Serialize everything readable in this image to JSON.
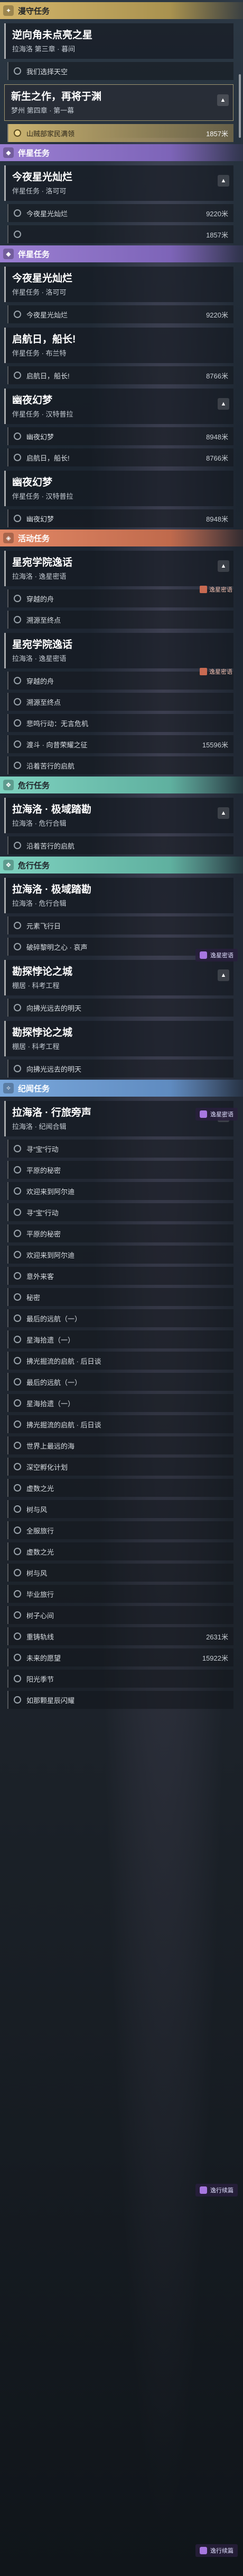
{
  "sections": [
    {
      "type": "cat",
      "style": "gold",
      "icon": "✦",
      "label": "漫守任务"
    },
    {
      "type": "quest",
      "title": "逆向角未点亮之星",
      "sub": "拉海洛 第三章 · 暮间",
      "badge": ""
    },
    {
      "type": "step",
      "label": "我们选择天空",
      "dist": ""
    },
    {
      "type": "quest",
      "sel": true,
      "title": "新生之作，再将于渊",
      "sub": "梦州 第四章 · 第一幕",
      "badge": "▲"
    },
    {
      "type": "step",
      "hl": true,
      "label": "山贼部家民满领",
      "dist": "1857米"
    },
    {
      "type": "cat",
      "style": "purple",
      "icon": "◆",
      "label": "伴星任务"
    },
    {
      "type": "quest",
      "title": "今夜星光灿烂",
      "sub": "伴星任务 · 洛可可",
      "badge": "▲"
    },
    {
      "type": "step",
      "label": "今夜星光灿烂",
      "dist": "9220米"
    },
    {
      "type": "step",
      "label": "",
      "dist": "1857米"
    },
    {
      "type": "cat",
      "style": "purple",
      "icon": "◆",
      "label": "伴星任务"
    },
    {
      "type": "quest",
      "title": "今夜星光灿烂",
      "sub": "伴星任务 · 洛可可",
      "badge": ""
    },
    {
      "type": "step",
      "label": "今夜星光灿烂",
      "dist": "9220米"
    },
    {
      "type": "quest",
      "title": "启航日，船长!",
      "sub": "伴星任务 · 布兰特",
      "badge": ""
    },
    {
      "type": "step",
      "label": "启航日，船长!",
      "dist": "8766米"
    },
    {
      "type": "quest",
      "title": "幽夜幻梦",
      "sub": "伴星任务 · 汉特普拉",
      "badge": "▲"
    },
    {
      "type": "step",
      "label": "幽夜幻梦",
      "dist": "8948米"
    },
    {
      "type": "step",
      "label": "启航日，船长!",
      "dist": "8766米"
    },
    {
      "type": "quest",
      "title": "幽夜幻梦",
      "sub": "伴星任务 · 汉特普拉",
      "badge": ""
    },
    {
      "type": "step",
      "label": "幽夜幻梦",
      "dist": "8948米"
    },
    {
      "type": "cat",
      "style": "orange",
      "icon": "◈",
      "label": "活动任务"
    },
    {
      "type": "quest",
      "title": "星宛学院逸话",
      "sub": "拉海洛 · 逸星密语",
      "badge": "▲",
      "flag": "逸星密语"
    },
    {
      "type": "step",
      "label": "穿越的舟",
      "dist": ""
    },
    {
      "type": "step",
      "label": "溯源至终点",
      "dist": ""
    },
    {
      "type": "quest",
      "title": "星宛学院逸话",
      "sub": "拉海洛 · 逸星密语",
      "badge": "",
      "flag": "逸星密语"
    },
    {
      "type": "step",
      "label": "穿越的舟",
      "dist": ""
    },
    {
      "type": "step",
      "label": "溯源至终点",
      "dist": ""
    },
    {
      "type": "step",
      "label": "悲鸣行动：无言危机",
      "dist": ""
    },
    {
      "type": "step",
      "label": "渡斗 · 向昔荣耀之征",
      "dist": "15596米"
    },
    {
      "type": "step",
      "label": "沿着苦行的启航",
      "dist": ""
    },
    {
      "type": "cat",
      "style": "teal",
      "icon": "❖",
      "label": "危行任务"
    },
    {
      "type": "quest",
      "title": "拉海洛 · 极域踏勘",
      "sub": "拉海洛 · 危行合辑",
      "badge": "▲"
    },
    {
      "type": "step",
      "label": "沿着苦行的启航",
      "dist": ""
    },
    {
      "type": "cat",
      "style": "teal",
      "icon": "❖",
      "label": "危行任务"
    },
    {
      "type": "quest",
      "title": "拉海洛 · 极域踏勘",
      "sub": "拉海洛 · 危行合辑",
      "badge": ""
    },
    {
      "type": "step",
      "label": "元素飞行日",
      "dist": ""
    },
    {
      "type": "step",
      "label": "破碎黎明之心 · 哀声",
      "dist": ""
    },
    {
      "type": "quest",
      "title": "勘探悖论之城",
      "sub": "棚居 · 科考工程",
      "badge": "▲"
    },
    {
      "type": "step",
      "label": "向拂光远去的明天",
      "dist": ""
    },
    {
      "type": "quest",
      "title": "勘探悖论之城",
      "sub": "棚居 · 科考工程",
      "badge": ""
    },
    {
      "type": "step",
      "label": "向拂光远去的明天",
      "dist": ""
    },
    {
      "type": "cat",
      "style": "blue",
      "icon": "✧",
      "label": "纪闻任务"
    },
    {
      "type": "quest",
      "title": "拉海洛 · 行旅旁声",
      "sub": "拉海洛 · 纪闻合辑",
      "badge": "▲"
    },
    {
      "type": "step",
      "label": "寻“宝”行动",
      "dist": ""
    },
    {
      "type": "step",
      "label": "平原的秘密",
      "dist": ""
    },
    {
      "type": "step",
      "label": "欢迎来到阿尔迪",
      "dist": ""
    },
    {
      "type": "step",
      "label": "寻“宝”行动",
      "dist": ""
    },
    {
      "type": "step",
      "label": "平原的秘密",
      "dist": ""
    },
    {
      "type": "step",
      "label": "欢迎来到阿尔迪",
      "dist": ""
    },
    {
      "type": "step",
      "label": "意外来客",
      "dist": ""
    },
    {
      "type": "step",
      "label": "秘密",
      "dist": ""
    },
    {
      "type": "step",
      "label": "最后的远航（一）",
      "dist": ""
    },
    {
      "type": "step",
      "label": "星海拾遗（一）",
      "dist": ""
    },
    {
      "type": "step",
      "label": "拂光掘流的启航 · 后日谈",
      "dist": ""
    },
    {
      "type": "step",
      "label": "最后的远航（一）",
      "dist": ""
    },
    {
      "type": "step",
      "label": "星海拾遗（一）",
      "dist": ""
    },
    {
      "type": "step",
      "label": "拂光掘流的启航 · 后日谈",
      "dist": ""
    },
    {
      "type": "step",
      "label": "世界上最远的海",
      "dist": ""
    },
    {
      "type": "step",
      "label": "深空孵化计划",
      "dist": ""
    },
    {
      "type": "step",
      "label": "虚数之光",
      "dist": ""
    },
    {
      "type": "step",
      "label": "树与风",
      "dist": ""
    },
    {
      "type": "step",
      "label": "全服旅行",
      "dist": ""
    },
    {
      "type": "step",
      "label": "虚数之光",
      "dist": ""
    },
    {
      "type": "step",
      "label": "树与风",
      "dist": ""
    },
    {
      "type": "step",
      "label": "毕业旅行",
      "dist": ""
    },
    {
      "type": "step",
      "label": "树子心间",
      "dist": ""
    },
    {
      "type": "step",
      "label": "重铸轨线",
      "dist": "2631米"
    },
    {
      "type": "step",
      "label": "未来的愿望",
      "dist": "15922米"
    },
    {
      "type": "step",
      "label": "阳光季节",
      "dist": ""
    },
    {
      "type": "step",
      "label": "如那颗星辰闪耀",
      "dist": ""
    }
  ],
  "chips": [
    {
      "label": "逸星密语"
    },
    {
      "label": "逸星密语"
    },
    {
      "label": "逸行续篇"
    },
    {
      "label": "逸行续篇"
    }
  ]
}
